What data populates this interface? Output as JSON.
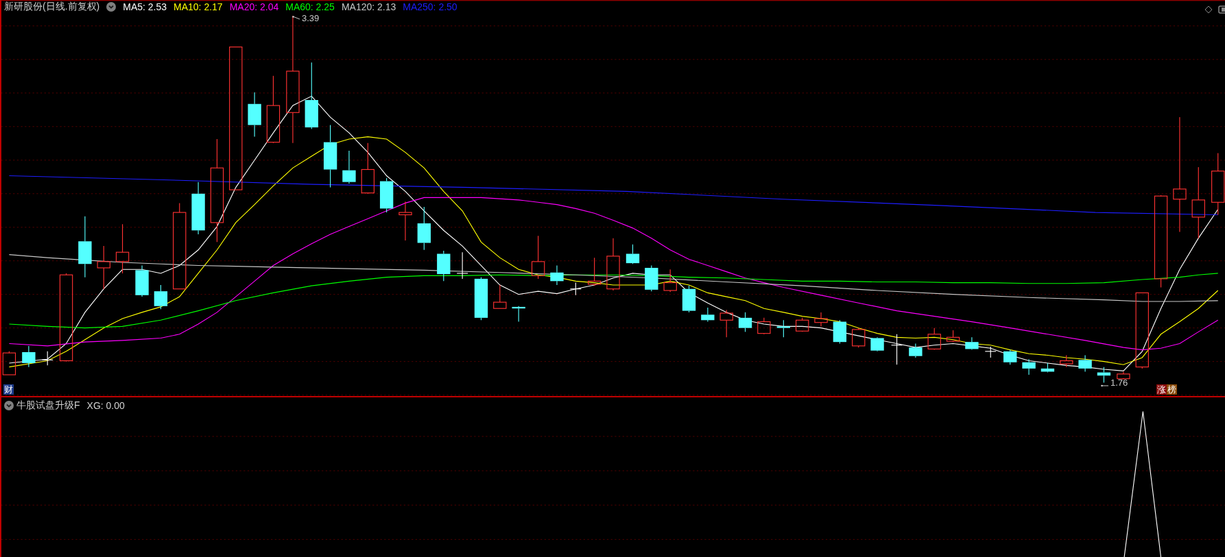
{
  "header": {
    "title": "新研股份(日线.前复权)",
    "moving_averages": [
      {
        "label": "MA5: 2.53",
        "color": "#ffffff"
      },
      {
        "label": "MA10: 2.17",
        "color": "#ffff00"
      },
      {
        "label": "MA20: 2.04",
        "color": "#ff00ff"
      },
      {
        "label": "MA60: 2.25",
        "color": "#00ff00"
      },
      {
        "label": "MA120: 2.13",
        "color": "#c8c8c8"
      },
      {
        "label": "MA250: 2.50",
        "color": "#1e1eff"
      }
    ]
  },
  "price_chart": {
    "high_label": "3.39",
    "low_label": "1.76",
    "finance_badge": "财",
    "rank_badges": [
      {
        "text": "涨",
        "color": "#8b0a0a"
      },
      {
        "text": "榜",
        "color": "#8a4a08"
      }
    ]
  },
  "indicator": {
    "name": "牛股试盘升级F",
    "reading": "XG: 0.00"
  }
}
